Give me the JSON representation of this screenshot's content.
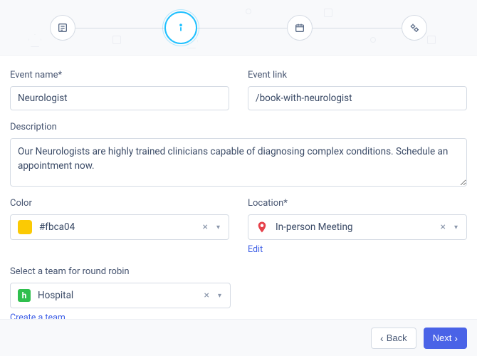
{
  "steps": {
    "list_icon": "list",
    "info_icon": "info",
    "calendar_icon": "calendar",
    "gears_icon": "gears"
  },
  "labels": {
    "event_name": "Event name*",
    "event_link": "Event link",
    "description": "Description",
    "color": "Color",
    "location": "Location*",
    "team": "Select a team for round robin"
  },
  "values": {
    "event_name": "Neurologist",
    "event_link": "/book-with-neurologist",
    "description": "Our Neurologists are highly trained clinicians capable of diagnosing complex conditions. Schedule an appointment now.",
    "color_hex": "#fbca04",
    "location": "In-person Meeting",
    "team": "Hospital"
  },
  "links": {
    "edit_location": "Edit",
    "create_team": "Create a team"
  },
  "buttons": {
    "back": "Back",
    "next": "Next"
  },
  "colors": {
    "accent": "#1ec0ff",
    "primary": "#4a63e7",
    "swatch": "#fbca04"
  }
}
